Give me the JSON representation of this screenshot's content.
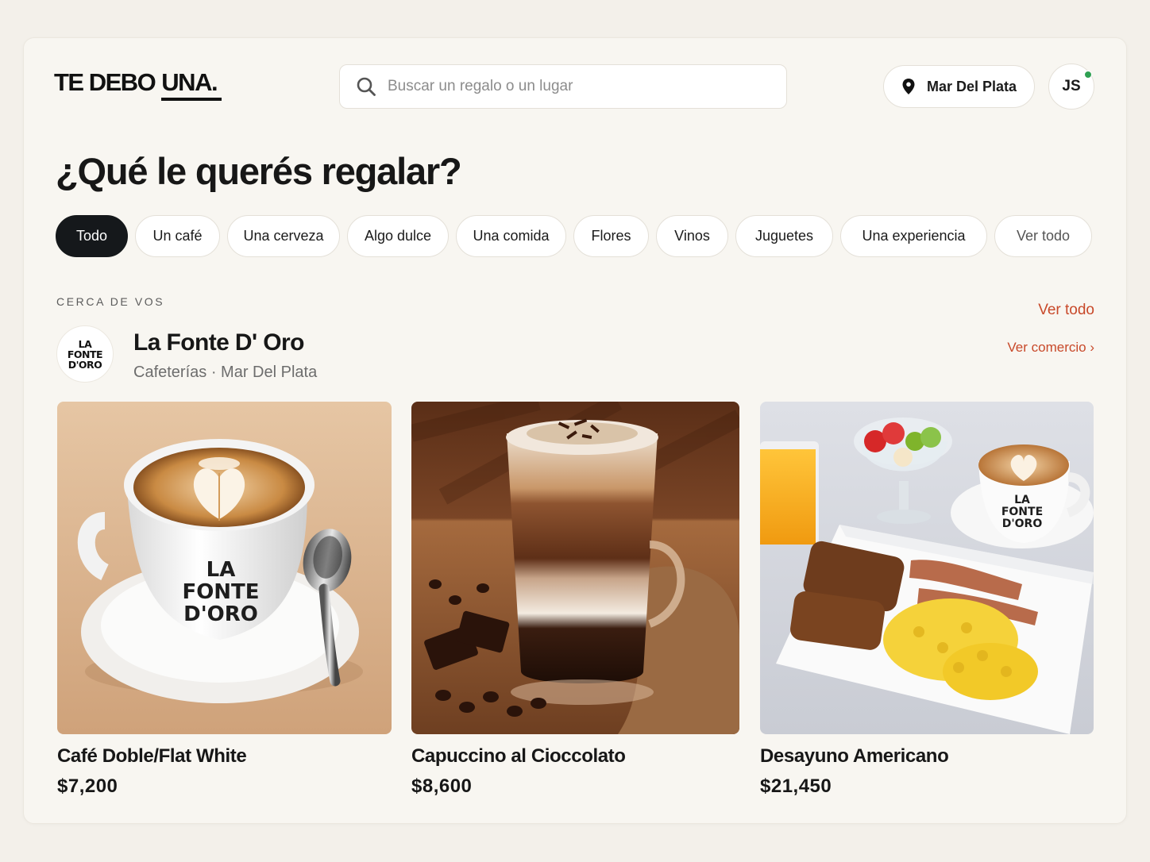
{
  "header": {
    "logo_part1": "TE DEBO",
    "logo_part2": "UNA",
    "logo_dot": ".",
    "search_placeholder": "Buscar un regalo o un lugar",
    "location": "Mar Del Plata",
    "user_initials": "JS"
  },
  "main": {
    "title": "¿Qué le querés regalar?",
    "chips": [
      {
        "label": "Todo",
        "active": true
      },
      {
        "label": "Un café"
      },
      {
        "label": "Una cerveza"
      },
      {
        "label": "Algo dulce"
      },
      {
        "label": "Una comida"
      },
      {
        "label": "Flores"
      },
      {
        "label": "Vinos"
      },
      {
        "label": "Juguetes"
      },
      {
        "label": "Una experiencia"
      },
      {
        "label": "Ver todo"
      }
    ],
    "section_eyebrow": "CERCA DE VOS",
    "section_see_all": "Ver todo"
  },
  "shop": {
    "logo_line1": "LA",
    "logo_line2": "FONTE",
    "logo_line3": "D'ORO",
    "name": "La Fonte D' Oro",
    "meta": "Cafeterías · Mar Del Plata",
    "link": "Ver comercio ›"
  },
  "products": [
    {
      "name": "Café Doble/Flat White",
      "price": "$7,200",
      "cup_text_1": "LA",
      "cup_text_2": "FONTE",
      "cup_text_3": "D'ORO"
    },
    {
      "name": "Capuccino al Cioccolato",
      "price": "$8,600"
    },
    {
      "name": "Desayuno Americano",
      "price": "$21,450",
      "cup_text_1": "LA",
      "cup_text_2": "FONTE",
      "cup_text_3": "D'ORO"
    }
  ],
  "colors": {
    "accent": "#c8492a",
    "chip_active": "#15181b",
    "online": "#2fa052",
    "background": "#f3f0ea"
  }
}
